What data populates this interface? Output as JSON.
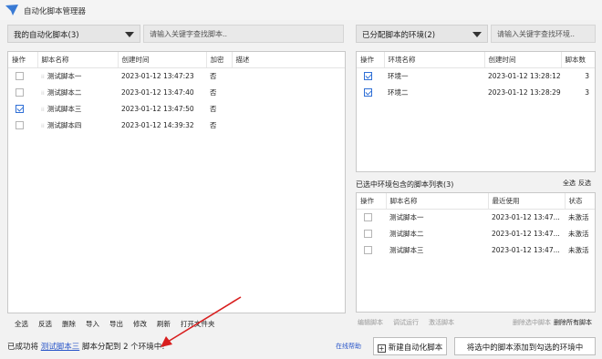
{
  "window": {
    "title": "自动化脚本管理器"
  },
  "left": {
    "dropdown_label": "我的自动化脚本(3)",
    "search_placeholder": "请输入关键字查找脚本..",
    "columns": [
      "操作",
      "脚本名称",
      "创建时间",
      "加密",
      "描述"
    ],
    "rows": [
      {
        "checked": false,
        "name": "测试脚本一",
        "created": "2023-01-12 13:47:23",
        "encrypted": "否",
        "desc": ""
      },
      {
        "checked": false,
        "name": "测试脚本二",
        "created": "2023-01-12 13:47:40",
        "encrypted": "否",
        "desc": ""
      },
      {
        "checked": true,
        "name": "测试脚本三",
        "created": "2023-01-12 13:47:50",
        "encrypted": "否",
        "desc": ""
      },
      {
        "checked": false,
        "name": "测试脚本四",
        "created": "2023-01-12 14:39:32",
        "encrypted": "否",
        "desc": ""
      }
    ],
    "toolbar": [
      "全选",
      "反选",
      "删除",
      "导入",
      "导出",
      "修改",
      "刷新",
      "打开文件夹"
    ]
  },
  "right": {
    "dropdown_label": "已分配脚本的环境(2)",
    "search_placeholder": "请输入关键字查找环境..",
    "columns": [
      "操作",
      "环境名称",
      "创建时间",
      "脚本数"
    ],
    "rows": [
      {
        "checked": true,
        "name": "环境一",
        "created": "2023-01-12 13:28:12",
        "count": "3"
      },
      {
        "checked": true,
        "name": "环境二",
        "created": "2023-01-12 13:28:29",
        "count": "3"
      }
    ]
  },
  "env_scripts": {
    "title": "已选中环境包含的脚本列表(3)",
    "select_all": "全选",
    "invert": "反选",
    "columns": [
      "操作",
      "脚本名称",
      "最近使用",
      "状态"
    ],
    "rows": [
      {
        "checked": false,
        "name": "测试脚本一",
        "last_used": "2023-01-12 13:47...",
        "status": "未激活"
      },
      {
        "checked": false,
        "name": "测试脚本二",
        "last_used": "2023-01-12 13:47...",
        "status": "未激活"
      },
      {
        "checked": false,
        "name": "测试脚本三",
        "last_used": "2023-01-12 13:47...",
        "status": "未激活"
      }
    ],
    "toolbar_disabled": [
      "编辑脚本",
      "调试运行",
      "激活脚本"
    ],
    "delete_selected": "删除选中脚本",
    "delete_all": "删除所有脚本"
  },
  "status": {
    "prefix": "已成功将",
    "script_link": "测试脚本三",
    "suffix": "脚本分配到 2 个环境中!"
  },
  "footer": {
    "online_help": "在线帮助",
    "new_script_button": "新建自动化脚本",
    "add_to_env_button": "将选中的脚本添加到勾选的环境中"
  },
  "colors": {
    "accent": "#2f6fd6",
    "link": "#2b57c9",
    "arrow": "#d81e1e"
  }
}
